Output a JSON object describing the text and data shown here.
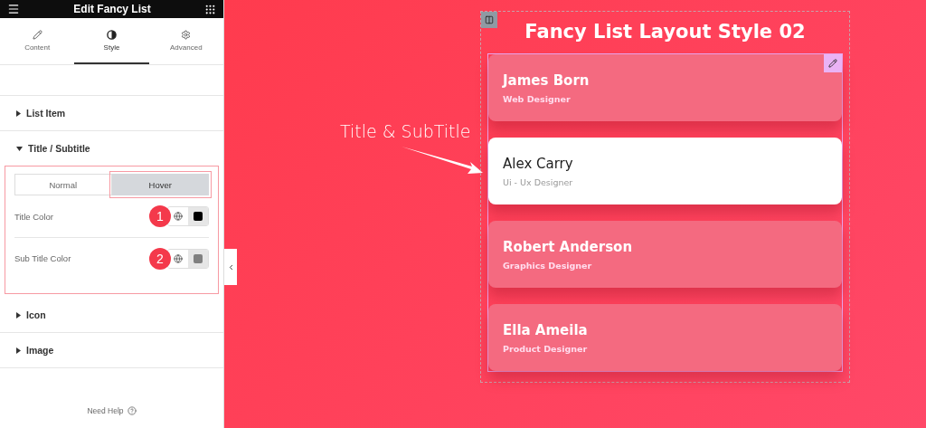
{
  "panel": {
    "title": "Edit Fancy List",
    "tabs": [
      {
        "label": "Content",
        "selected": false
      },
      {
        "label": "Style",
        "selected": true
      },
      {
        "label": "Advanced",
        "selected": false
      }
    ],
    "sections": [
      {
        "label": "List Item",
        "expanded": false
      },
      {
        "label": "Title / Subtitle",
        "expanded": true,
        "states": [
          {
            "label": "Normal",
            "selected": false
          },
          {
            "label": "Hover",
            "selected": true
          }
        ],
        "controls": [
          {
            "label": "Title Color",
            "badge": "1",
            "color": "#000000"
          },
          {
            "label": "Sub Title Color",
            "badge": "2",
            "color": "#808080"
          }
        ]
      },
      {
        "label": "Icon",
        "expanded": false
      },
      {
        "label": "Image",
        "expanded": false
      }
    ],
    "help": "Need Help"
  },
  "canvas": {
    "heading": "Fancy List Layout Style 02",
    "annotation": "Title & SubTitle",
    "items": [
      {
        "title": "James Born",
        "subtitle": "Web Designer",
        "selected": false
      },
      {
        "title": "Alex Carry",
        "subtitle": "Ui - Ux Designer",
        "selected": true
      },
      {
        "title": "Robert Anderson",
        "subtitle": "Graphics Designer",
        "selected": false
      },
      {
        "title": "Ella Ameila",
        "subtitle": "Product Designer",
        "selected": false
      }
    ]
  }
}
